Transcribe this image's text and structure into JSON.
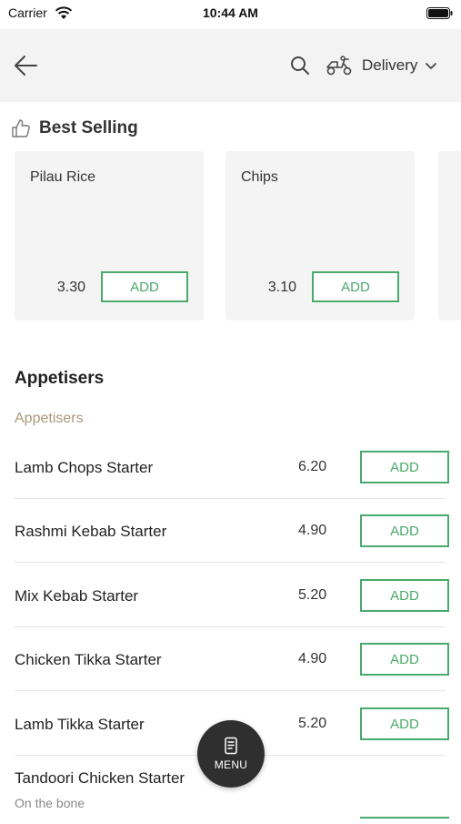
{
  "status_bar": {
    "carrier": "Carrier",
    "time": "10:44 AM"
  },
  "header": {
    "delivery_label": "Delivery"
  },
  "best_selling": {
    "title": "Best Selling",
    "items": [
      {
        "name": "Pilau Rice",
        "price": "3.30",
        "add_label": "ADD"
      },
      {
        "name": "Chips",
        "price": "3.10",
        "add_label": "ADD"
      }
    ]
  },
  "category": {
    "title": "Appetisers",
    "subcategory": "Appetisers",
    "items": [
      {
        "name": "Lamb Chops Starter",
        "price": "6.20",
        "add_label": "ADD"
      },
      {
        "name": "Rashmi Kebab Starter",
        "price": "4.90",
        "add_label": "ADD"
      },
      {
        "name": "Mix Kebab Starter",
        "price": "5.20",
        "add_label": "ADD"
      },
      {
        "name": "Chicken Tikka Starter",
        "price": "4.90",
        "add_label": "ADD"
      },
      {
        "name": "Lamb Tikka Starter",
        "price": "5.20",
        "add_label": "ADD"
      },
      {
        "name": "Tandoori Chicken Starter",
        "description": "On the bone"
      }
    ]
  },
  "menu_button": {
    "label": "MENU"
  }
}
